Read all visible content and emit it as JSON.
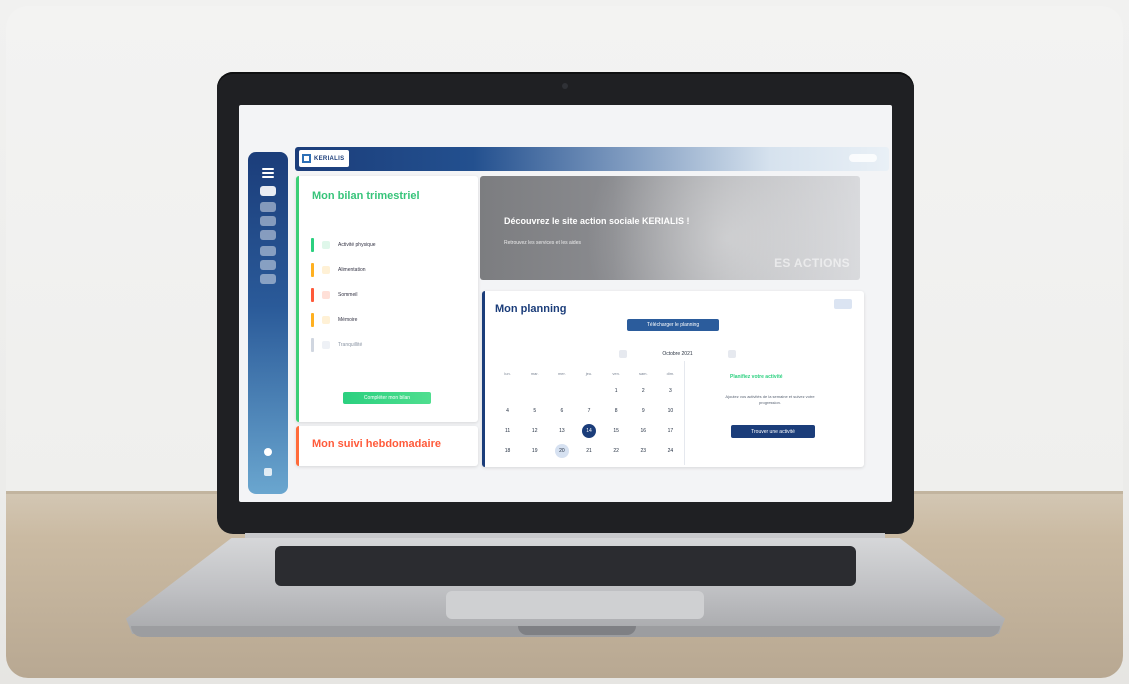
{
  "app": {
    "brand": "KERIALIS"
  },
  "bilan": {
    "title": "Mon bilan trimestriel",
    "items": [
      {
        "label": "Activité physique",
        "color": "#2bd07f",
        "icon": "running-icon"
      },
      {
        "label": "Alimentation",
        "color": "#ffb020",
        "icon": "food-icon"
      },
      {
        "label": "Sommeil",
        "color": "#ff5a3a",
        "icon": "moon-icon"
      },
      {
        "label": "Mémoire",
        "color": "#ffb020",
        "icon": "brain-icon"
      },
      {
        "label": "Tranquillité",
        "color": "#d0d6e0",
        "icon": "cloud-icon"
      }
    ],
    "cta": "Compléter mon bilan"
  },
  "suivi": {
    "title": "Mon suivi hebdomadaire"
  },
  "hero": {
    "title": "Découvrez le site action sociale KERIALIS !",
    "subtitle": "Retrouvez les services et les aides",
    "watermark": "ES ACTIONS"
  },
  "planning": {
    "title": "Mon planning",
    "button": "Télécharger le planning",
    "month": "Octobre 2021",
    "weekdays": [
      "lun.",
      "mar.",
      "mer.",
      "jeu.",
      "ven.",
      "sam.",
      "dim."
    ],
    "rows": [
      [
        "",
        "",
        "",
        "",
        "1",
        "2",
        "3"
      ],
      [
        "4",
        "5",
        "6",
        "7",
        "8",
        "9",
        "10"
      ],
      [
        "11",
        "12",
        "13",
        "14",
        "15",
        "16",
        "17"
      ],
      [
        "18",
        "19",
        "20",
        "21",
        "22",
        "23",
        "24"
      ]
    ],
    "today": "14",
    "selected": "20",
    "side": {
      "title": "Planifiez votre activité",
      "text": "Ajoutez vos activités de la semaine et suivez votre progression.",
      "button": "Trouver une activité"
    }
  }
}
